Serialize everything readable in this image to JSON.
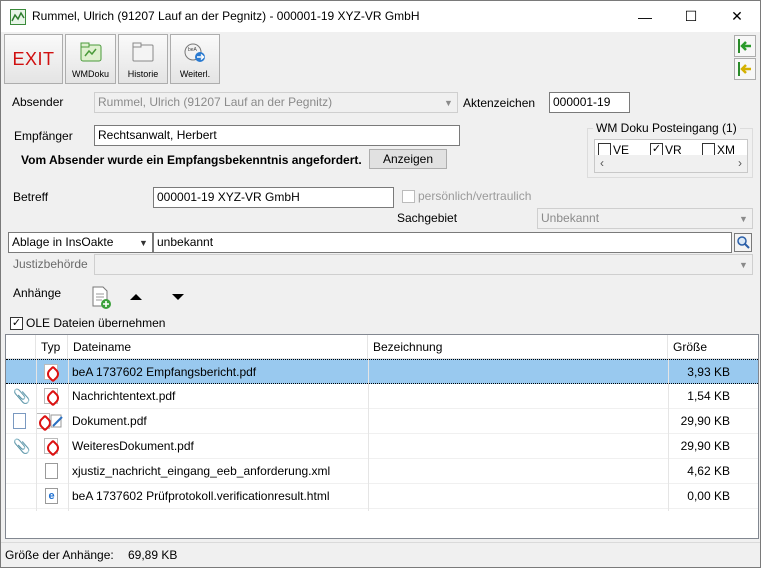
{
  "window": {
    "title": "Rummel, Ulrich (91207 Lauf an der Pegnitz) - 000001-19 XYZ-VR GmbH",
    "minimize": "—",
    "maximize": "☐",
    "close": "✕"
  },
  "toolbar": {
    "exit_label": "EXIT",
    "wmdoku_label": "WMDoku",
    "historie_label": "Historie",
    "weiterl_label": "Weiterl."
  },
  "form": {
    "absender_label": "Absender",
    "absender_value": "Rummel, Ulrich (91207 Lauf an der Pegnitz)",
    "aktenzeichen_label": "Aktenzeichen",
    "aktenzeichen_value": "000001-19",
    "empfaenger_label": "Empfänger",
    "empfaenger_value": "Rechtsanwalt, Herbert",
    "notice_text": "Vom Absender wurde ein Empfangsbekenntnis angefordert.",
    "anzeigen_label": "Anzeigen",
    "betreff_label": "Betreff",
    "betreff_value": "000001-19 XYZ-VR GmbH",
    "vertraulich_label": "persönlich/vertraulich",
    "sachgebiet_label": "Sachgebiet",
    "sachgebiet_value": "Unbekannt",
    "ablage_value": "Ablage in InsOakte",
    "ablage_target_value": "unbekannt",
    "justiz_label": "Justizbehörde",
    "justiz_value": "",
    "anhaenge_label": "Anhänge",
    "ole_label": "OLE Dateien übernehmen",
    "ole_checked": true
  },
  "posteingang": {
    "title": "WM Doku Posteingang (1)",
    "options": [
      {
        "label": "VE",
        "checked": false
      },
      {
        "label": "VR",
        "checked": true
      },
      {
        "label": "XM",
        "checked": false
      }
    ]
  },
  "table": {
    "headers": {
      "typ": "Typ",
      "dateiname": "Dateiname",
      "bezeichnung": "Bezeichnung",
      "groesse": "Größe"
    },
    "rows": [
      {
        "name": "beA 1737602 Empfangsbericht.pdf",
        "bezeichnung": "",
        "size": "3,93 KB",
        "type": "pdf",
        "attach": "none",
        "selected": true
      },
      {
        "name": "Nachrichtentext.pdf",
        "bezeichnung": "",
        "size": "1,54 KB",
        "type": "pdf",
        "attach": "clip",
        "selected": false
      },
      {
        "name": "Dokument.pdf",
        "bezeichnung": "",
        "size": "29,90 KB",
        "type": "pdf-signed",
        "attach": "doc",
        "selected": false
      },
      {
        "name": "WeiteresDokument.pdf",
        "bezeichnung": "",
        "size": "29,90 KB",
        "type": "pdf",
        "attach": "clip",
        "selected": false
      },
      {
        "name": "xjustiz_nachricht_eingang_eeb_anforderung.xml",
        "bezeichnung": "",
        "size": "4,62 KB",
        "type": "file",
        "attach": "none",
        "selected": false
      },
      {
        "name": "beA 1737602 Prüfprotokoll.verificationresult.html",
        "bezeichnung": "",
        "size": "0,00 KB",
        "type": "html",
        "attach": "none",
        "selected": false
      }
    ]
  },
  "status": {
    "label": "Größe der Anhänge:",
    "value": "69,89 KB"
  }
}
